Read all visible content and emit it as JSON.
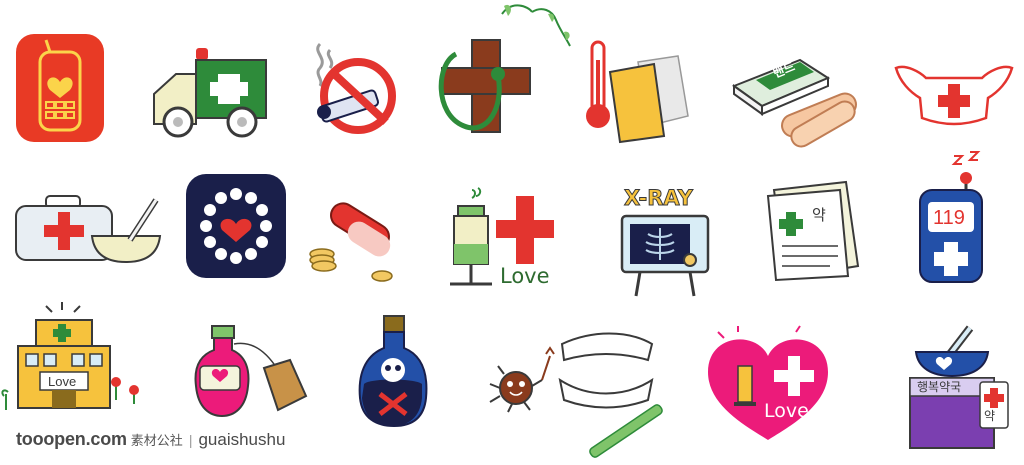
{
  "icons": {
    "xray_text": "X-RAY",
    "phone_119_text": "119",
    "iv_love_text": "Love",
    "hospital_love_text": "Love",
    "heart_love_text": "Love",
    "bandage_box_text": "밴드",
    "prescription_text": "약",
    "pharmacy_sign_text": "행복약국",
    "pharmacy_tag_text": "약"
  },
  "watermark": {
    "site": "tooopen.com",
    "site_cn": "素材公社",
    "separator": "|",
    "user": "guaishushu"
  },
  "colors": {
    "red": "#e3342f",
    "green": "#2e8b3a",
    "navy": "#1a1f4a",
    "pink": "#ec1b7a",
    "blue": "#2350a8",
    "orange": "#f4a928",
    "outline": "#3a3a3a"
  }
}
